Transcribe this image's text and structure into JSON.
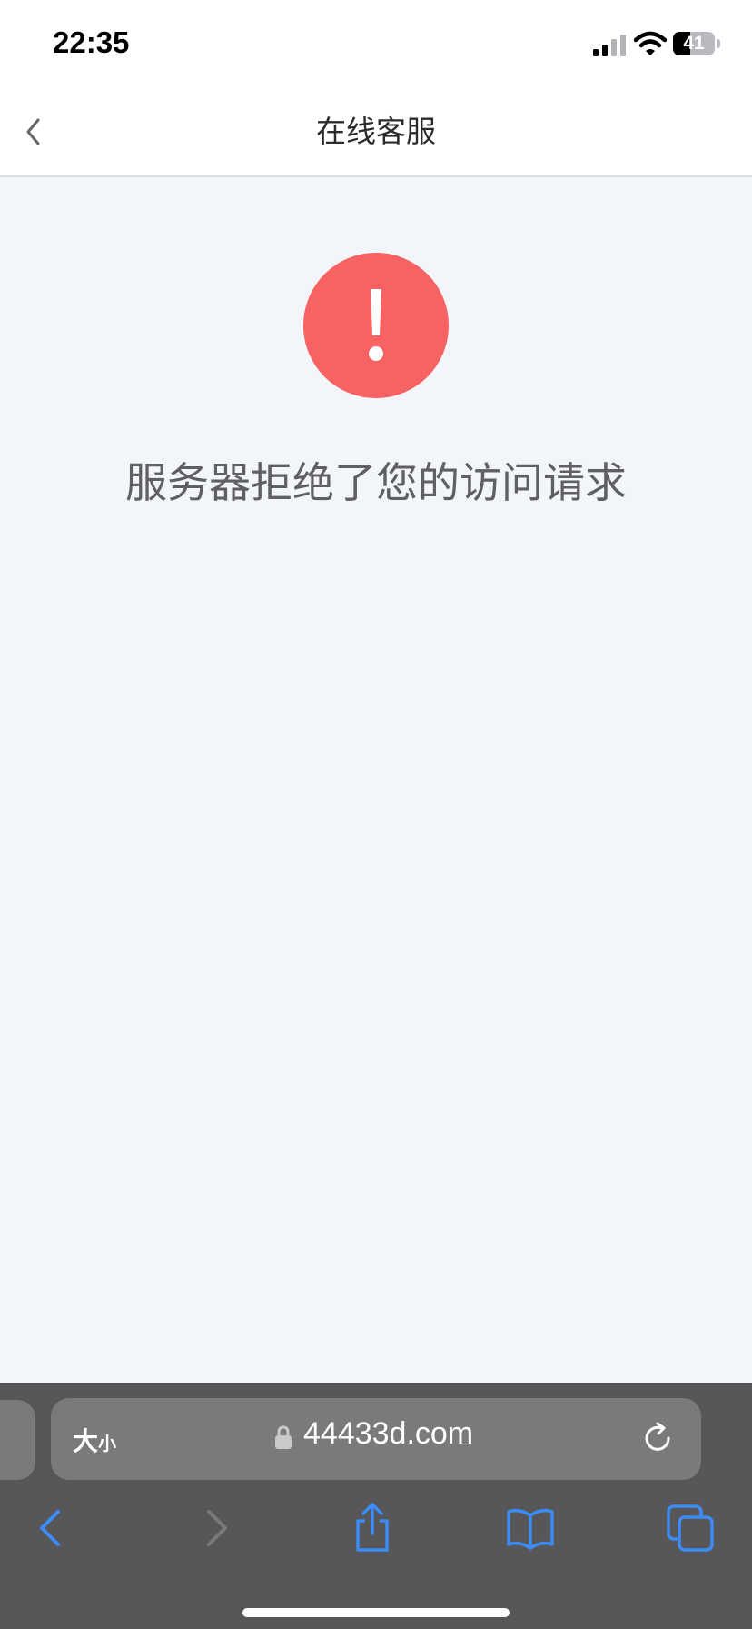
{
  "status_bar": {
    "time": "22:35",
    "battery_level": "41"
  },
  "nav": {
    "title": "在线客服",
    "back_icon": "chevron-left-icon"
  },
  "error": {
    "icon": "exclamation-circle-icon",
    "icon_color": "#f76263",
    "message": "服务器拒绝了您的访问请求"
  },
  "browser": {
    "text_size_large": "大",
    "text_size_small": "小",
    "url": "44433d.com",
    "lock_icon": "lock-icon",
    "reload_icon": "reload-icon",
    "toolbar": [
      "back-icon",
      "forward-icon",
      "share-icon",
      "bookmarks-icon",
      "tabs-icon"
    ],
    "accent_color": "#3b8cf4"
  }
}
